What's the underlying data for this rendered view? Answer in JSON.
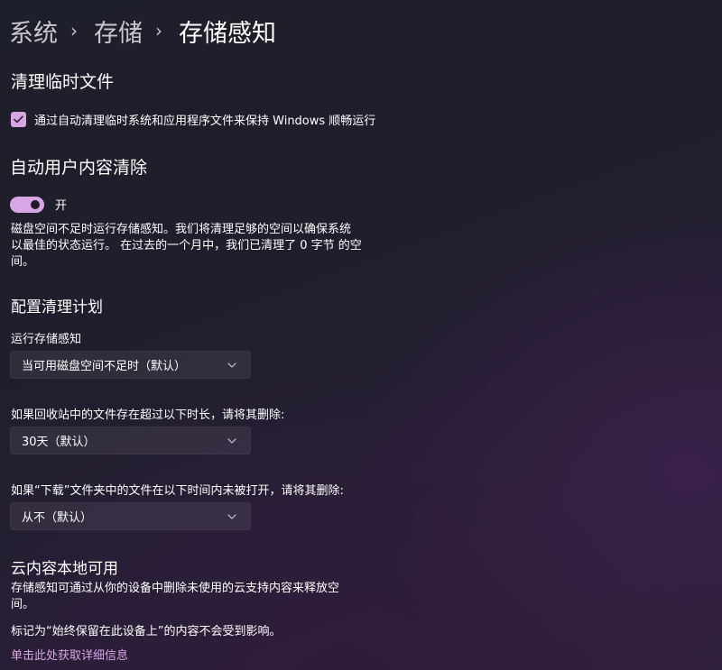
{
  "breadcrumb": {
    "items": [
      "系统",
      "存储",
      "存储感知"
    ],
    "separator": "›"
  },
  "temp_files": {
    "heading": "清理临时文件",
    "checkbox_label": "通过自动清理临时系统和应用程序文件来保持 Windows 顺畅运行",
    "checked": true
  },
  "auto_cleanup": {
    "heading": "自动用户内容清除",
    "toggle_label": "开",
    "toggle_on": true,
    "description_line1": "磁盘空间不足时运行存储感知。我们将清理足够的空间以确保系统",
    "description_line2": "以最佳的状态运行。 在过去的一个月中，我们已清理了 0 字节 的空",
    "description_line3": "间。"
  },
  "schedule": {
    "heading": "配置清理计划",
    "run_label": "运行存储感知",
    "run_value": "当可用磁盘空间不足时（默认）",
    "recycle_label": "如果回收站中的文件存在超过以下时长，请将其删除:",
    "recycle_value": "30天（默认）",
    "downloads_label": "如果“下载”文件夹中的文件在以下时间内未被打开，请将其删除:",
    "downloads_value": "从不（默认）"
  },
  "cloud": {
    "heading": "云内容本地可用",
    "description_line1": "存储感知可通过从你的设备中删除未使用的云支持内容来释放空",
    "description_line2": "间。",
    "note": "标记为“始终保留在此设备上”的内容不会受到影响。",
    "link": "单击此处获取详细信息"
  },
  "colors": {
    "accent": "#d8a6e4",
    "text": "#ffffff",
    "breadcrumb_parent": "#c9c7cf"
  },
  "icons": {
    "checkbox": "checkmark-icon",
    "dropdown": "chevron-down-icon"
  }
}
